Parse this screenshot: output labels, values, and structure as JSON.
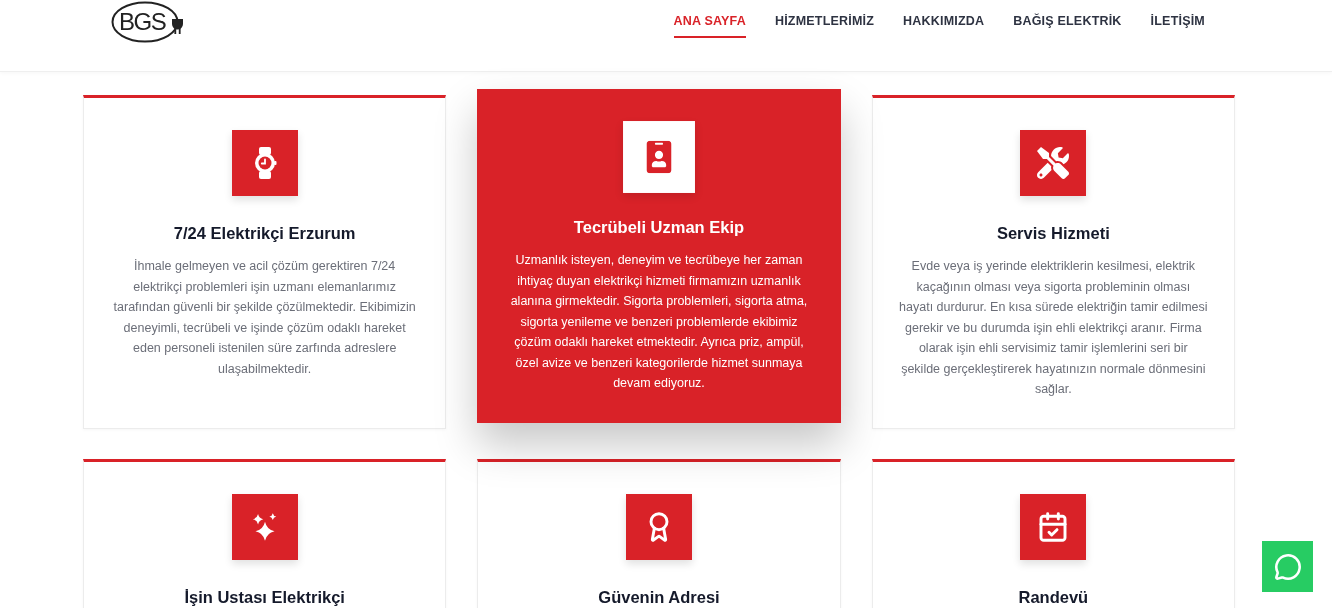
{
  "header": {
    "logo": "BGS",
    "nav": [
      {
        "label": "ANA SAYFA",
        "selected": true
      },
      {
        "label": "HİZMETLERİMİZ",
        "selected": false
      },
      {
        "label": "HAKKIMIZDA",
        "selected": false
      },
      {
        "label": "BAĞIŞ ELEKTRİK",
        "selected": false
      },
      {
        "label": "İLETİŞİM",
        "selected": false
      }
    ]
  },
  "cards": [
    {
      "title": "7/24 Elektrikçi Erzurum",
      "body": "İhmale gelmeyen ve acil çözüm gerektiren 7/24 elektrikçi problemleri işin uzmanı elemanlarımız tarafından güvenli bir şekilde çözülmektedir. Ekibimizin deneyimli, tecrübeli ve işinde çözüm odaklı hareket eden personeli istenilen süre zarfında adreslere ulaşabilmektedir.",
      "active": false
    },
    {
      "title": "Tecrübeli Uzman Ekip",
      "body": "Uzmanlık isteyen, deneyim ve tecrübeye her zaman ihtiyaç duyan elektrikçi hizmeti firmamızın uzmanlık alanına girmektedir. Sigorta problemleri, sigorta atma, sigorta yenileme ve benzeri problemlerde ekibimiz çözüm odaklı hareket etmektedir. Ayrıca priz, ampül, özel avize ve benzeri kategorilerde hizmet sunmaya devam ediyoruz.",
      "active": true
    },
    {
      "title": "Servis Hizmeti",
      "body": "Evde veya iş yerinde elektriklerin kesilmesi, elektrik kaçağının olması veya sigorta probleminin olması hayatı durdurur. En kısa sürede elektriğin tamir edilmesi gerekir ve bu durumda işin ehli elektrikçi aranır. Firma olarak işin ehli servisimiz tamir işlemlerini seri bir şekilde gerçekleştirerek hayatınızın normale dönmesini sağlar.",
      "active": false
    },
    {
      "title": "İşin Ustası Elektrikçi",
      "active": false
    },
    {
      "title": "Güvenin Adresi",
      "active": false
    },
    {
      "title": "Randevü",
      "active": false
    }
  ]
}
